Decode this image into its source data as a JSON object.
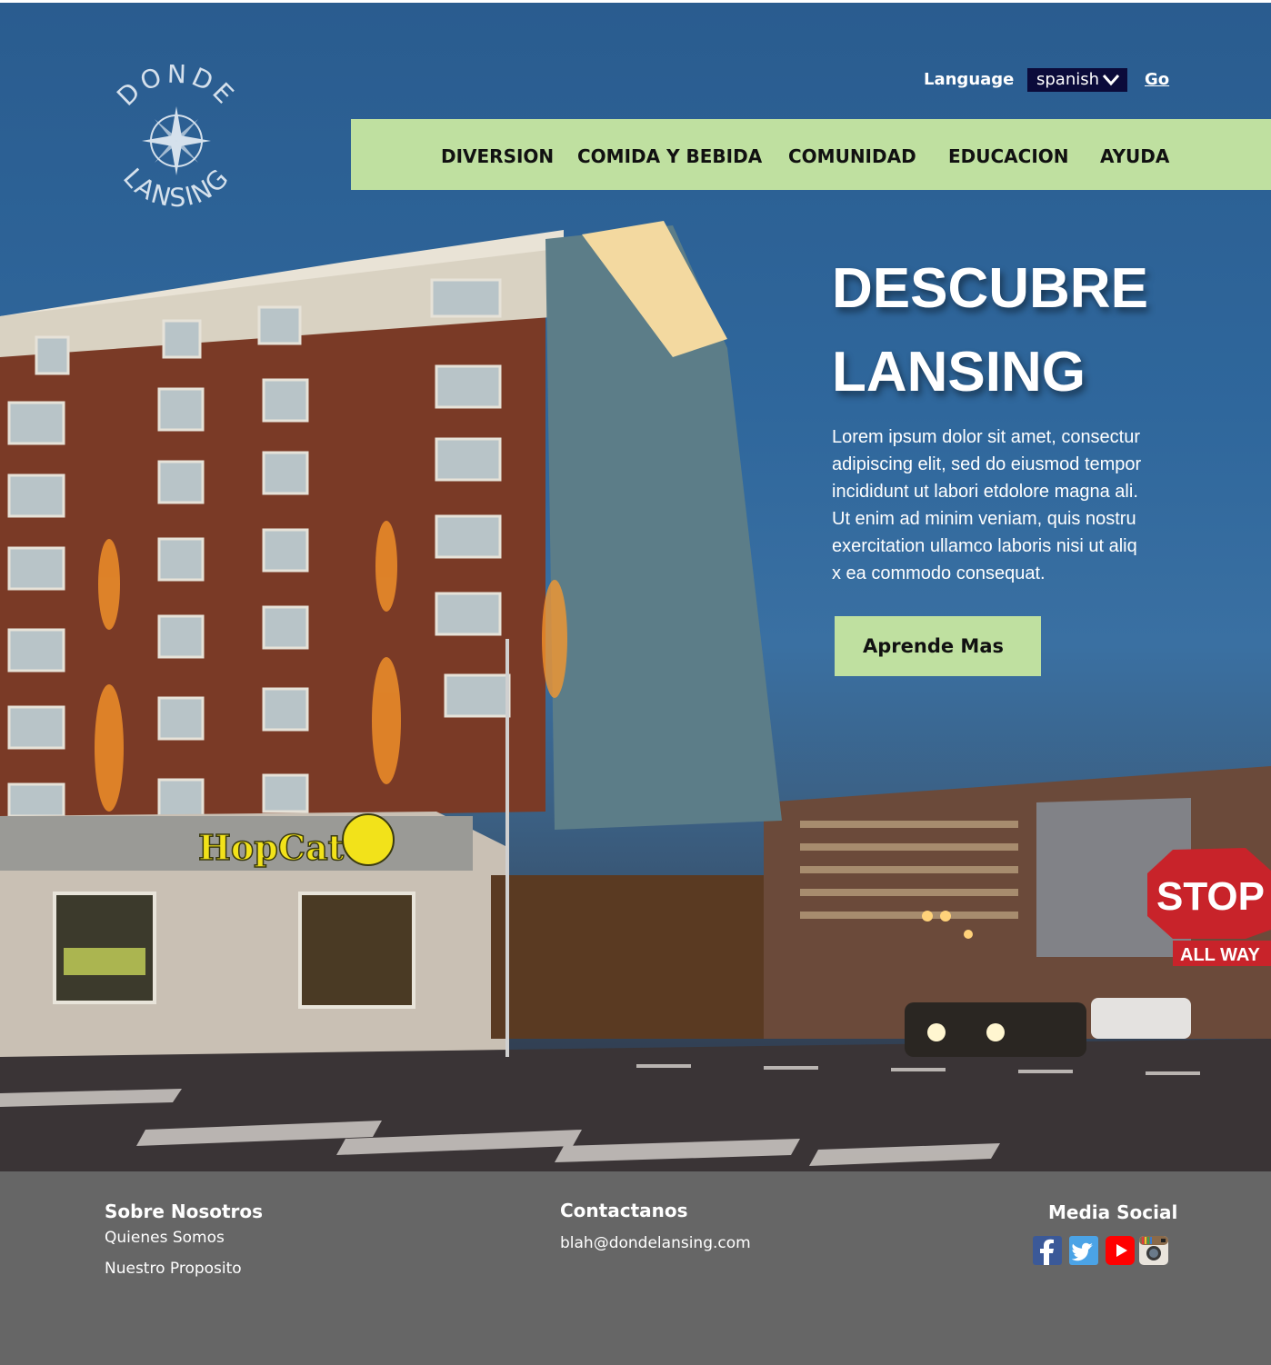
{
  "header": {
    "language_label": "Language",
    "language_selected": "spanish",
    "go_label": "Go",
    "logo_text_top": "DONDE",
    "logo_text_bottom": "LANSING"
  },
  "nav": {
    "items": [
      {
        "label": "DIVERSION"
      },
      {
        "label": "COMIDA Y BEBIDA"
      },
      {
        "label": "COMUNIDAD"
      },
      {
        "label": "EDUCACION"
      },
      {
        "label": "AYUDA"
      }
    ]
  },
  "hero": {
    "title_line1": "DESCUBRE",
    "title_line2": "LANSING",
    "body": "Lorem ipsum dolor sit amet, consectur\nadipiscing elit, sed do eiusmod tempor\n incididunt ut labori etdolore magna ali.\n Ut enim ad minim veniam, quis nostru\nexercitation ullamco laboris nisi ut aliq\nx ea commodo consequat.",
    "cta_label": "Aprende Mas",
    "photo_signs": {
      "restaurant": "HopCat",
      "stop": "STOP",
      "all_way": "ALL WAY"
    }
  },
  "footer": {
    "about": {
      "heading": "Sobre Nosotros",
      "links": [
        "Quienes Somos",
        "Nuestro Proposito"
      ]
    },
    "contact": {
      "heading": "Contactanos",
      "email": "blah@dondelansing.com"
    },
    "social": {
      "heading": "Media Social",
      "icons": [
        "facebook-icon",
        "twitter-icon",
        "youtube-icon",
        "instagram-icon"
      ]
    }
  },
  "colors": {
    "nav_bg": "#bfe0a0",
    "footer_bg": "#666666",
    "language_select_bg": "#0b0b3a",
    "sky_blue": "#2f679c"
  }
}
